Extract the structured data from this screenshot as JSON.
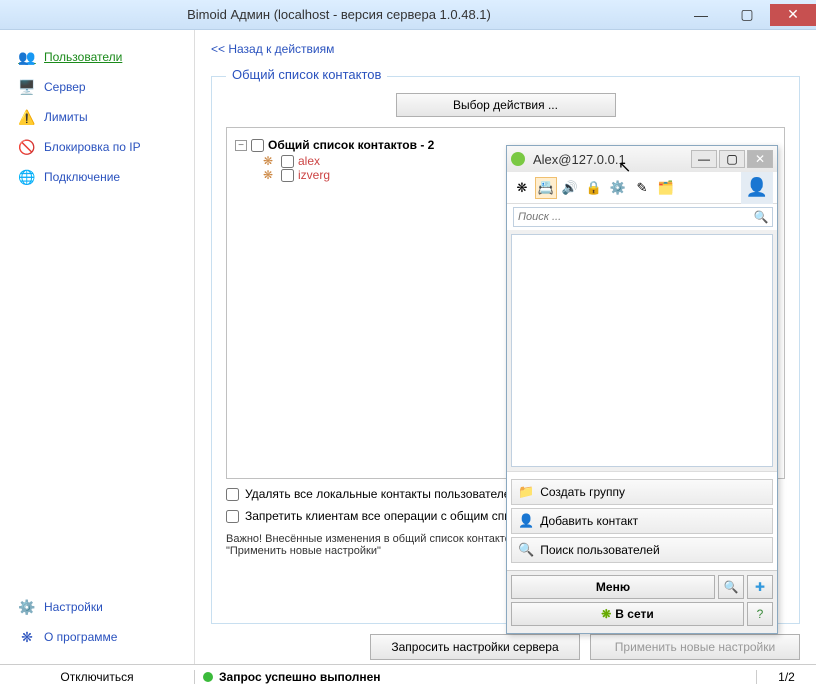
{
  "window": {
    "title": "Bimoid Админ (localhost - версия сервера 1.0.48.1)"
  },
  "sidebar": {
    "items": [
      {
        "label": "Пользователи"
      },
      {
        "label": "Сервер"
      },
      {
        "label": "Лимиты"
      },
      {
        "label": "Блокировка по IP"
      },
      {
        "label": "Подключение"
      }
    ],
    "bottom": [
      {
        "label": "Настройки"
      },
      {
        "label": "О программе"
      }
    ]
  },
  "content": {
    "back": "<< Назад к действиям",
    "legend": "Общий список контактов",
    "action_button": "Выбор действия ...",
    "tree_root": "Общий список контактов - 2",
    "contacts": [
      {
        "name": "alex"
      },
      {
        "name": "izverg"
      }
    ],
    "check_delete": "Удалять все локальные контакты пользователей",
    "check_forbid": "Запретить клиентам все операции с общим списком",
    "note": "Важно! Внесённые изменения в общий список контактов вступят в силу только после нажатия на кнопку \"Применить новые настройки\"",
    "btn_request": "Запросить настройки сервера",
    "btn_apply": "Применить новые настройки"
  },
  "status": {
    "disconnect": "Отключиться",
    "message": "Запрос успешно выполнен",
    "page": "1/2"
  },
  "child": {
    "title": "Alex@127.0.0.1",
    "search_placeholder": "Поиск ...",
    "actions": [
      {
        "label": "Создать группу"
      },
      {
        "label": "Добавить контакт"
      },
      {
        "label": "Поиск пользователей"
      }
    ],
    "menu": "Меню",
    "online": "В сети"
  }
}
